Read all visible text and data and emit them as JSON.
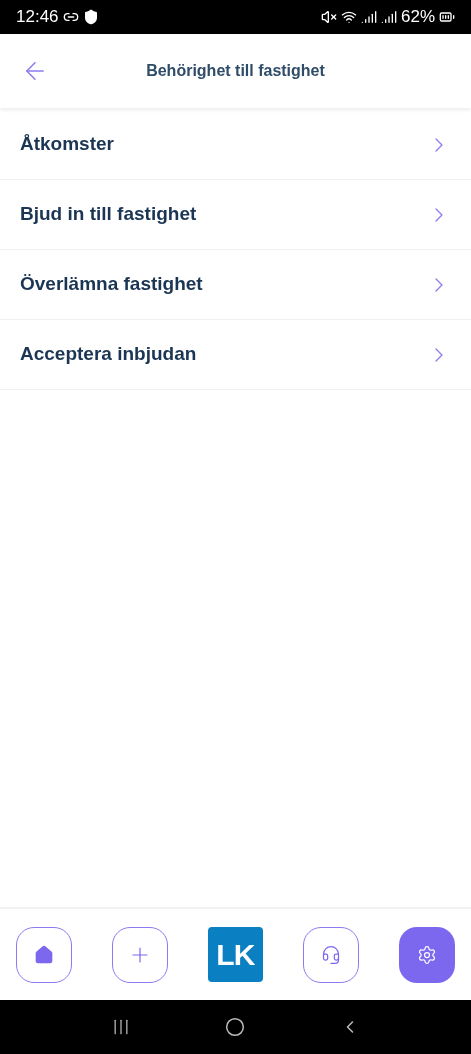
{
  "status_bar": {
    "time": "12:46",
    "battery": "62%"
  },
  "header": {
    "title": "Behörighet till fastighet"
  },
  "menu": [
    {
      "label": "Åtkomster"
    },
    {
      "label": "Bjud in till fastighet"
    },
    {
      "label": "Överlämna fastighet"
    },
    {
      "label": "Acceptera inbjudan"
    }
  ],
  "bottom_nav": [
    {
      "kind": "home",
      "selected": false
    },
    {
      "kind": "add",
      "selected": false
    },
    {
      "kind": "logo",
      "text": "LK",
      "selected": false
    },
    {
      "kind": "support",
      "selected": false
    },
    {
      "kind": "settings",
      "selected": true
    }
  ]
}
